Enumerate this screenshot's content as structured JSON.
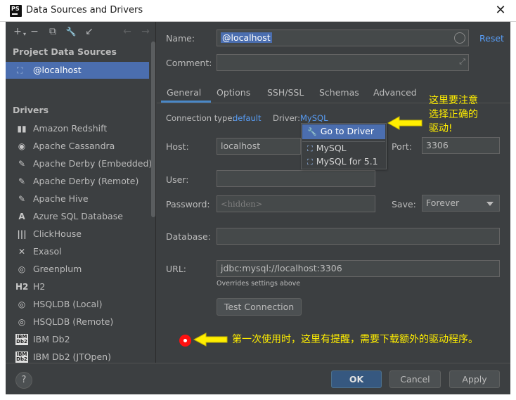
{
  "window": {
    "title": "Data Sources and Drivers",
    "app_icon": "PS",
    "close_glyph": "✕"
  },
  "toolbar": {
    "add": "+",
    "add_arrow": "▾",
    "remove": "−",
    "copy": "⧉",
    "wrench": "🔧",
    "import": "↙",
    "back": "←",
    "forward": "→"
  },
  "left": {
    "project_title": "Project Data Sources",
    "selected_source": "@localhost",
    "drivers_title": "Drivers",
    "drivers": [
      {
        "label": "Amazon Redshift",
        "icon": "▮▮"
      },
      {
        "label": "Apache Cassandra",
        "icon": "◉"
      },
      {
        "label": "Apache Derby (Embedded)",
        "icon": "✎"
      },
      {
        "label": "Apache Derby (Remote)",
        "icon": "✎"
      },
      {
        "label": "Apache Hive",
        "icon": "✎"
      },
      {
        "label": "Azure SQL Database",
        "icon": "A"
      },
      {
        "label": "ClickHouse",
        "icon": "|||"
      },
      {
        "label": "Exasol",
        "icon": "✕"
      },
      {
        "label": "Greenplum",
        "icon": "◎"
      },
      {
        "label": "H2",
        "icon": "H2"
      },
      {
        "label": "HSQLDB (Local)",
        "icon": "◎"
      },
      {
        "label": "HSQLDB (Remote)",
        "icon": "◎"
      },
      {
        "label": "IBM Db2",
        "icon": "IBM Db2"
      },
      {
        "label": "IBM Db2 (JTOpen)",
        "icon": "IBM Db2"
      }
    ]
  },
  "form": {
    "name_label": "Name:",
    "name_value": "@localhost",
    "reset": "Reset",
    "comment_label": "Comment:",
    "tabs": [
      "General",
      "Options",
      "SSH/SSL",
      "Schemas",
      "Advanced"
    ],
    "connection_type_label": "Connection type:",
    "connection_type_value": "default",
    "driver_label": "Driver:",
    "driver_value": "MySQL",
    "host_label": "Host:",
    "host_value": "localhost",
    "port_label": "Port:",
    "port_value": "3306",
    "user_label": "User:",
    "password_label": "Password:",
    "password_placeholder": "<hidden>",
    "save_label": "Save:",
    "save_value": "Forever",
    "database_label": "Database:",
    "url_label": "URL:",
    "url_value": "jdbc:mysql://localhost:3306",
    "url_note": "Overrides settings above",
    "test_button": "Test Connection"
  },
  "driver_popup": {
    "items": [
      "Go to Driver",
      "MySQL",
      "MySQL for 5.1"
    ]
  },
  "buttons": {
    "help": "?",
    "ok": "OK",
    "cancel": "Cancel",
    "apply": "Apply"
  },
  "annotations": {
    "note1_line1": "这里要注意",
    "note1_line2": "选择正确的",
    "note1_line3": "驱动!",
    "note2": "第一次使用时，这里有提醒，需要下载额外的驱动程序。"
  },
  "colors": {
    "accent": "#4b6eaf",
    "link": "#589df6",
    "annotation": "#ffee00",
    "marker": "#ff1010"
  }
}
